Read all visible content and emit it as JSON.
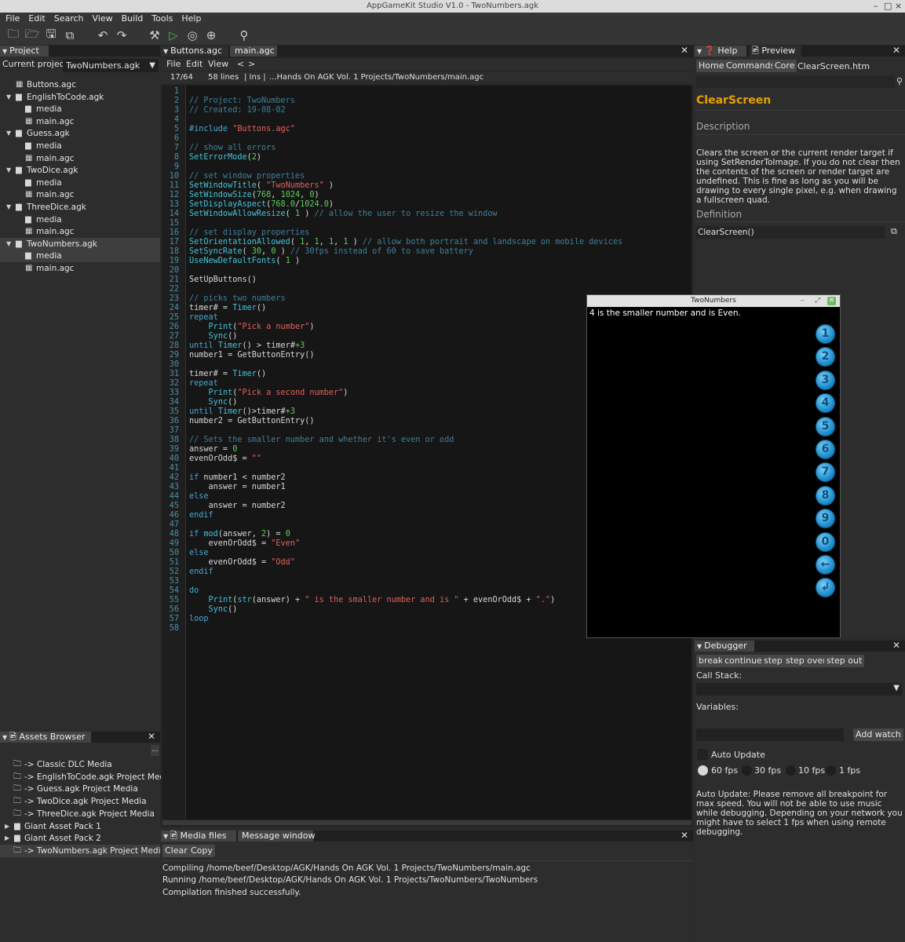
{
  "window": {
    "title": "AppGameKit Studio V1.0 - TwoNumbers.agk",
    "min": "–",
    "max": "□",
    "close": "×"
  },
  "menu": [
    "File",
    "Edit",
    "Search",
    "View",
    "Build",
    "Tools",
    "Help"
  ],
  "toolbar_icons": [
    "new-project-icon",
    "open-project-icon",
    "save-icon",
    "save-all-icon",
    "undo-icon",
    "redo-icon",
    "build-icon",
    "run-icon",
    "broadcast-icon",
    "debug-icon",
    "search-icon"
  ],
  "project": {
    "tab": "Project",
    "current_label": "Current project:",
    "current_value": "TwoNumbers.agk",
    "tree": [
      {
        "label": "Buttons.agc",
        "indent": 0,
        "type": "file"
      },
      {
        "label": "EnglishToCode.agk",
        "indent": 0,
        "type": "folder",
        "expanded": true
      },
      {
        "label": "media",
        "indent": 1,
        "type": "folder"
      },
      {
        "label": "main.agc",
        "indent": 1,
        "type": "file"
      },
      {
        "label": "Guess.agk",
        "indent": 0,
        "type": "folder",
        "expanded": true
      },
      {
        "label": "media",
        "indent": 1,
        "type": "folder"
      },
      {
        "label": "main.agc",
        "indent": 1,
        "type": "file"
      },
      {
        "label": "TwoDice.agk",
        "indent": 0,
        "type": "folder",
        "expanded": true
      },
      {
        "label": "media",
        "indent": 1,
        "type": "folder"
      },
      {
        "label": "main.agc",
        "indent": 1,
        "type": "file"
      },
      {
        "label": "ThreeDice.agk",
        "indent": 0,
        "type": "folder",
        "expanded": true
      },
      {
        "label": "media",
        "indent": 1,
        "type": "folder"
      },
      {
        "label": "main.agc",
        "indent": 1,
        "type": "file"
      },
      {
        "label": "TwoNumbers.agk",
        "indent": 0,
        "type": "folder",
        "expanded": true,
        "sel": true
      },
      {
        "label": "media",
        "indent": 1,
        "type": "folder",
        "sel": true
      },
      {
        "label": "main.agc",
        "indent": 1,
        "type": "file"
      }
    ]
  },
  "assets": {
    "tab": "Assets Browser",
    "more": "...",
    "items": [
      {
        "label": "-> Classic DLC Media",
        "arrow": false
      },
      {
        "label": "-> EnglishToCode.agk Project Media",
        "arrow": false
      },
      {
        "label": "-> Guess.agk Project Media",
        "arrow": false
      },
      {
        "label": "-> TwoDice.agk Project Media",
        "arrow": false
      },
      {
        "label": "-> ThreeDice.agk Project Media",
        "arrow": false
      },
      {
        "label": "Giant Asset Pack 1",
        "arrow": true
      },
      {
        "label": "Giant Asset Pack 2",
        "arrow": true
      },
      {
        "label": "-> TwoNumbers.agk Project Media",
        "arrow": false,
        "sel": true
      }
    ]
  },
  "editor": {
    "tabs": [
      "Buttons.agc",
      "main.agc"
    ],
    "menu": [
      "File",
      "Edit",
      "View",
      "<",
      ">"
    ],
    "status": {
      "pos": "17/64",
      "lines": "58 lines",
      "mode": "| Ins |",
      "path": "...Hands On AGK Vol. 1 Projects/TwoNumbers/main.agc"
    },
    "lines": [
      [],
      [
        [
          "c",
          "// Project: TwoNumbers"
        ]
      ],
      [
        [
          "c",
          "// Created: 19-08-02"
        ]
      ],
      [],
      [
        [
          "k",
          "#include "
        ],
        [
          "s",
          "\"Buttons.agc\""
        ]
      ],
      [],
      [
        [
          "c",
          "// show all errors"
        ]
      ],
      [
        [
          "f",
          "SetErrorMode"
        ],
        [
          "t",
          "("
        ],
        [
          "n",
          "2"
        ],
        [
          "t",
          ")"
        ]
      ],
      [],
      [
        [
          "c",
          "// set window properties"
        ]
      ],
      [
        [
          "f",
          "SetWindowTitle"
        ],
        [
          "t",
          "( "
        ],
        [
          "s",
          "\"TwoNumbers\""
        ],
        [
          "t",
          " )"
        ]
      ],
      [
        [
          "f",
          "SetWindowSize"
        ],
        [
          "t",
          "("
        ],
        [
          "n",
          "768"
        ],
        [
          "t",
          ", "
        ],
        [
          "n",
          "1024"
        ],
        [
          "t",
          ", "
        ],
        [
          "n",
          "0"
        ],
        [
          "t",
          ")"
        ]
      ],
      [
        [
          "f",
          "SetDisplayAspect"
        ],
        [
          "t",
          "("
        ],
        [
          "n",
          "768.0"
        ],
        [
          "t",
          "/"
        ],
        [
          "n",
          "1024.0"
        ],
        [
          "t",
          ")"
        ]
      ],
      [
        [
          "f",
          "SetWindowAllowResize"
        ],
        [
          "t",
          "( "
        ],
        [
          "n",
          "1"
        ],
        [
          "t",
          " ) "
        ],
        [
          "c",
          "// allow the user to resize the window"
        ]
      ],
      [],
      [
        [
          "c",
          "// set display properties"
        ]
      ],
      [
        [
          "f",
          "SetOrientationAllowed"
        ],
        [
          "t",
          "( "
        ],
        [
          "n",
          "1"
        ],
        [
          "t",
          ", "
        ],
        [
          "n",
          "1"
        ],
        [
          "t",
          ", "
        ],
        [
          "n",
          "1"
        ],
        [
          "t",
          ", "
        ],
        [
          "n",
          "1"
        ],
        [
          "t",
          " ) "
        ],
        [
          "c",
          "// allow both portrait and landscape on mobile devices"
        ]
      ],
      [
        [
          "f",
          "SetSyncRate"
        ],
        [
          "t",
          "( "
        ],
        [
          "n",
          "30"
        ],
        [
          "t",
          ", "
        ],
        [
          "n",
          "0"
        ],
        [
          "t",
          " ) "
        ],
        [
          "c",
          "// 30fps instead of 60 to save battery"
        ]
      ],
      [
        [
          "f",
          "UseNewDefaultFonts"
        ],
        [
          "t",
          "( "
        ],
        [
          "n",
          "1"
        ],
        [
          "t",
          " )"
        ]
      ],
      [],
      [
        [
          "t",
          "SetUpButtons()"
        ]
      ],
      [],
      [
        [
          "c",
          "// picks two numbers"
        ]
      ],
      [
        [
          "t",
          "timer# = "
        ],
        [
          "f",
          "Timer"
        ],
        [
          "t",
          "()"
        ]
      ],
      [
        [
          "k",
          "repeat"
        ]
      ],
      [
        [
          "t",
          "    "
        ],
        [
          "f",
          "Print"
        ],
        [
          "t",
          "("
        ],
        [
          "s",
          "\"Pick a number\""
        ],
        [
          "t",
          ")"
        ]
      ],
      [
        [
          "t",
          "    "
        ],
        [
          "f",
          "Sync"
        ],
        [
          "t",
          "()"
        ]
      ],
      [
        [
          "k",
          "until "
        ],
        [
          "f",
          "Timer"
        ],
        [
          "t",
          "() > timer#"
        ],
        [
          "n",
          "+3"
        ]
      ],
      [
        [
          "t",
          "number1 = GetButtonEntry()"
        ]
      ],
      [],
      [
        [
          "t",
          "timer# = "
        ],
        [
          "f",
          "Timer"
        ],
        [
          "t",
          "()"
        ]
      ],
      [
        [
          "k",
          "repeat"
        ]
      ],
      [
        [
          "t",
          "    "
        ],
        [
          "f",
          "Print"
        ],
        [
          "t",
          "("
        ],
        [
          "s",
          "\"Pick a second number\""
        ],
        [
          "t",
          ")"
        ]
      ],
      [
        [
          "t",
          "    "
        ],
        [
          "f",
          "Sync"
        ],
        [
          "t",
          "()"
        ]
      ],
      [
        [
          "k",
          "until "
        ],
        [
          "f",
          "Timer"
        ],
        [
          "t",
          "()>timer#"
        ],
        [
          "n",
          "+3"
        ]
      ],
      [
        [
          "t",
          "number2 = GetButtonEntry()"
        ]
      ],
      [],
      [
        [
          "c",
          "// Sets the smaller number and whether it's even or odd"
        ]
      ],
      [
        [
          "t",
          "answer = "
        ],
        [
          "n",
          "0"
        ]
      ],
      [
        [
          "t",
          "evenOrOdd$ = "
        ],
        [
          "s",
          "\"\""
        ]
      ],
      [],
      [
        [
          "k",
          "if "
        ],
        [
          "t",
          "number1 < number2"
        ]
      ],
      [
        [
          "t",
          "    answer = number1"
        ]
      ],
      [
        [
          "k",
          "else"
        ]
      ],
      [
        [
          "t",
          "    answer = number2"
        ]
      ],
      [
        [
          "k",
          "endif"
        ]
      ],
      [],
      [
        [
          "k",
          "if "
        ],
        [
          "f",
          "mod"
        ],
        [
          "t",
          "(answer, "
        ],
        [
          "n",
          "2"
        ],
        [
          "t",
          ") = "
        ],
        [
          "n",
          "0"
        ]
      ],
      [
        [
          "t",
          "    evenOrOdd$ = "
        ],
        [
          "s",
          "\"Even\""
        ]
      ],
      [
        [
          "k",
          "else"
        ]
      ],
      [
        [
          "t",
          "    evenOrOdd$ = "
        ],
        [
          "s",
          "\"Odd\""
        ]
      ],
      [
        [
          "k",
          "endif"
        ]
      ],
      [],
      [
        [
          "k",
          "do"
        ]
      ],
      [
        [
          "t",
          "    "
        ],
        [
          "f",
          "Print"
        ],
        [
          "t",
          "("
        ],
        [
          "f",
          "str"
        ],
        [
          "t",
          "(answer) + "
        ],
        [
          "s",
          "\" is the smaller number and is \""
        ],
        [
          "t",
          " + evenOrOdd$ + "
        ],
        [
          "s",
          "\".\""
        ],
        [
          "t",
          ")"
        ]
      ],
      [
        [
          "t",
          "    "
        ],
        [
          "f",
          "Sync"
        ],
        [
          "t",
          "()"
        ]
      ],
      [
        [
          "k",
          "loop"
        ]
      ],
      []
    ]
  },
  "game": {
    "title": "TwoNumbers",
    "text": "4 is the smaller number and is Even.",
    "buttons": [
      "1",
      "2",
      "3",
      "4",
      "5",
      "6",
      "7",
      "8",
      "9",
      "0",
      "←",
      "↲"
    ]
  },
  "help": {
    "tabs": [
      "Help",
      "Preview"
    ],
    "nav": [
      "Home",
      "Commands",
      "Core"
    ],
    "page": "ClearScreen.htm",
    "heading": "ClearScreen",
    "desc_label": "Description",
    "desc": "Clears the screen or the current render target if using SetRenderToImage. If you do not clear then the contents of the screen or render target are undefined. This is fine as long as you will be drawing to every single pixel, e.g. when drawing a fullscreen quad.",
    "def_label": "Definition",
    "def": "ClearScreen()"
  },
  "debugger": {
    "tab": "Debugger",
    "buttons": [
      "break",
      "continue",
      "step",
      "step over",
      "step out"
    ],
    "callstack_label": "Call Stack:",
    "variables_label": "Variables:",
    "add_watch": "Add watch",
    "auto_update": "Auto Update",
    "fps": [
      "60 fps",
      "30 fps",
      "10 fps",
      "1 fps"
    ],
    "fps_selected": "60 fps",
    "note": "Auto Update: Please remove all breakpoint for max speed. You will not be able to use music while debugging. Depending on your network you might have to select 1 fps when using remote debugging."
  },
  "messages": {
    "tabs": [
      "Media files",
      "Message window"
    ],
    "buttons": [
      "Clear",
      "Copy"
    ],
    "lines": [
      "Compiling /home/beef/Desktop/AGK/Hands On AGK Vol. 1 Projects/TwoNumbers/main.agc",
      "Running /home/beef/Desktop/AGK/Hands On AGK Vol. 1 Projects/TwoNumbers/TwoNumbers",
      "Compilation finished successfully."
    ]
  }
}
